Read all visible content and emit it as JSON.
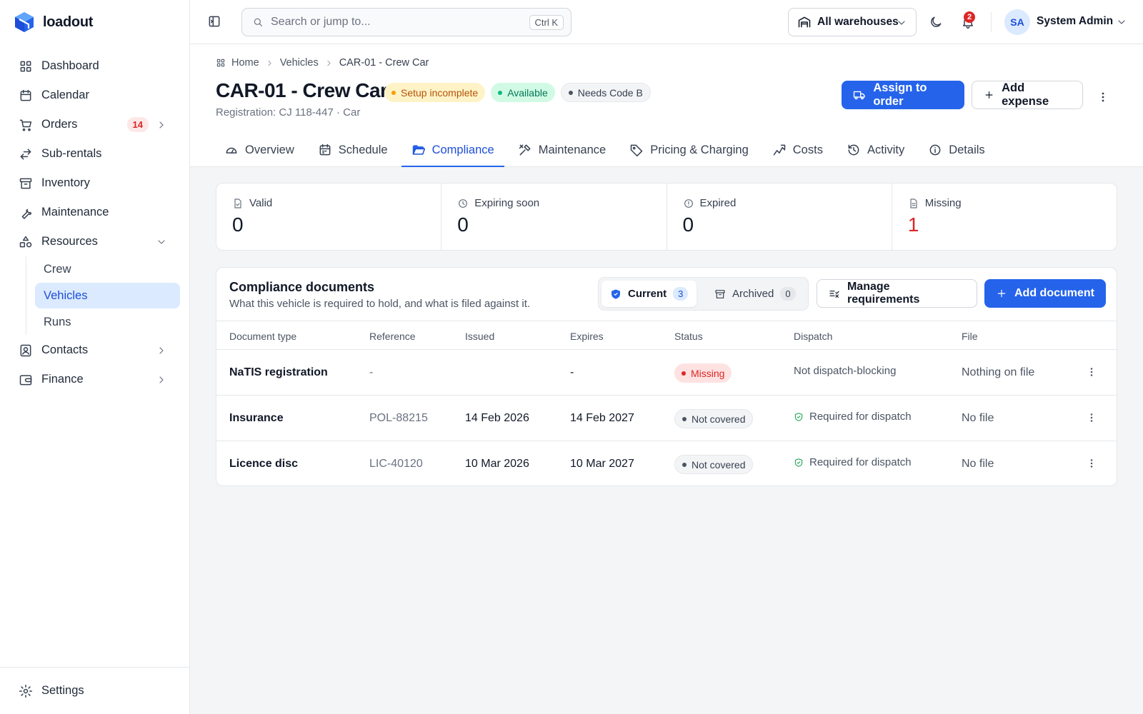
{
  "app": {
    "name": "loadout"
  },
  "sidebar": {
    "items": [
      {
        "label": "Dashboard"
      },
      {
        "label": "Calendar"
      },
      {
        "label": "Orders",
        "badge": "14"
      },
      {
        "label": "Sub-rentals"
      },
      {
        "label": "Inventory"
      },
      {
        "label": "Maintenance"
      },
      {
        "label": "Resources"
      },
      {
        "label": "Contacts"
      },
      {
        "label": "Finance"
      }
    ],
    "resources_sub": [
      "Crew",
      "Vehicles",
      "Runs"
    ],
    "settings_label": "Settings"
  },
  "topbar": {
    "search_placeholder": "Search or jump to...",
    "search_shortcut": "Ctrl K",
    "warehouse": "All warehouses",
    "notifications": "2",
    "user_initials": "SA",
    "user_name": "System Admin"
  },
  "page": {
    "breadcrumb": [
      "Home",
      "Vehicles",
      "CAR-01 - Crew Car"
    ],
    "title": "CAR-01 - Crew Car",
    "pills": [
      "Setup incomplete",
      "Available",
      "Needs Code B"
    ],
    "subtitle": "Registration: CJ 118-447 · Car",
    "assign_label": "Assign to order",
    "expense_label": "Add expense",
    "tabs": [
      "Overview",
      "Schedule",
      "Compliance",
      "Maintenance",
      "Pricing & Charging",
      "Costs",
      "Activity",
      "Details"
    ],
    "active_tab": "Compliance"
  },
  "stats": [
    {
      "label": "Valid",
      "value": "0"
    },
    {
      "label": "Expiring soon",
      "value": "0"
    },
    {
      "label": "Expired",
      "value": "0"
    },
    {
      "label": "Missing",
      "value": "1"
    }
  ],
  "documents": {
    "title": "Compliance documents",
    "subtitle": "What this vehicle is required to hold, and what is filed against it.",
    "segment": {
      "current_label": "Current",
      "current_count": "3",
      "archived_label": "Archived",
      "archived_count": "0"
    },
    "manage_label": "Manage requirements",
    "add_label": "Add document",
    "columns": [
      "Document type",
      "Reference",
      "Issued",
      "Expires",
      "Status",
      "Dispatch",
      "File"
    ],
    "rows": [
      {
        "type": "NaTIS registration",
        "reference": "-",
        "issued": "",
        "expires": "-",
        "status": "Missing",
        "dispatch": "Not dispatch-blocking",
        "file": "Nothing on file"
      },
      {
        "type": "Insurance",
        "reference": "POL-88215",
        "issued": "14 Feb 2026",
        "expires": "14 Feb 2027",
        "status": "Not covered",
        "dispatch": "Required for dispatch",
        "file": "No file"
      },
      {
        "type": "Licence disc",
        "reference": "LIC-40120",
        "issued": "10 Mar 2026",
        "expires": "10 Mar 2027",
        "status": "Not covered",
        "dispatch": "Required for dispatch",
        "file": "No file"
      }
    ]
  },
  "colors": {
    "accent": "#2563eb",
    "danger": "#dc2626",
    "warning": "#b45309",
    "success": "#047857"
  }
}
